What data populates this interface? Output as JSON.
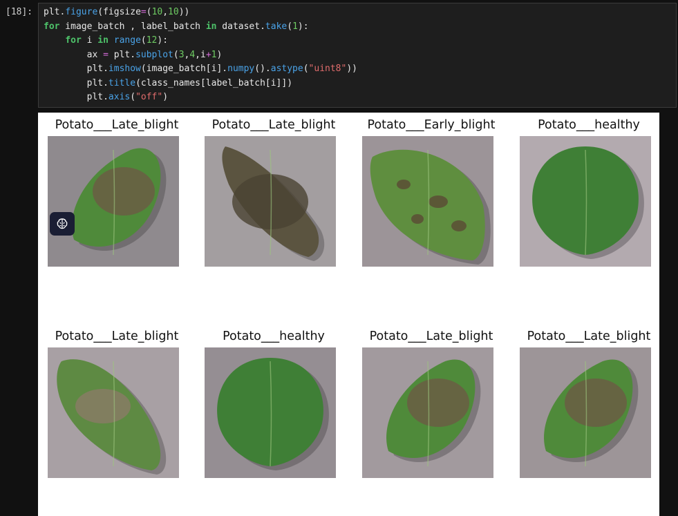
{
  "cell": {
    "prompt": "[18]:",
    "code_lines": [
      "plt.figure(figsize=(10,10))",
      "for image_batch , label_batch in dataset.take(1):",
      "    for i in range(12):",
      "        ax = plt.subplot(3,4,i+1)",
      "        plt.imshow(image_batch[i].numpy().astype(\"uint8\"))",
      "        plt.title(class_names[label_batch[i]])",
      "        plt.axis(\"off\")"
    ]
  },
  "output": {
    "subplots": [
      {
        "title": "Potato___Late_blight",
        "leaf": "late"
      },
      {
        "title": "Potato___Late_blight",
        "leaf": "dried"
      },
      {
        "title": "Potato___Early_blight",
        "leaf": "early"
      },
      {
        "title": "Potato___healthy",
        "leaf": "healthy"
      },
      {
        "title": "Potato___Late_blight",
        "leaf": "curled"
      },
      {
        "title": "Potato___healthy",
        "leaf": "healthy"
      },
      {
        "title": "Potato___Late_blight",
        "leaf": "late"
      },
      {
        "title": "Potato___Late_blight",
        "leaf": "late"
      }
    ]
  },
  "overlay": {
    "icon": "brain-icon"
  },
  "colors": {
    "background": "#111111",
    "cell_bg": "#1e1e1e",
    "keyword": "#4ec36a",
    "function": "#4aa3e8",
    "number": "#6ecb63",
    "string": "#e06c6c",
    "operator": "#d16ad6"
  }
}
